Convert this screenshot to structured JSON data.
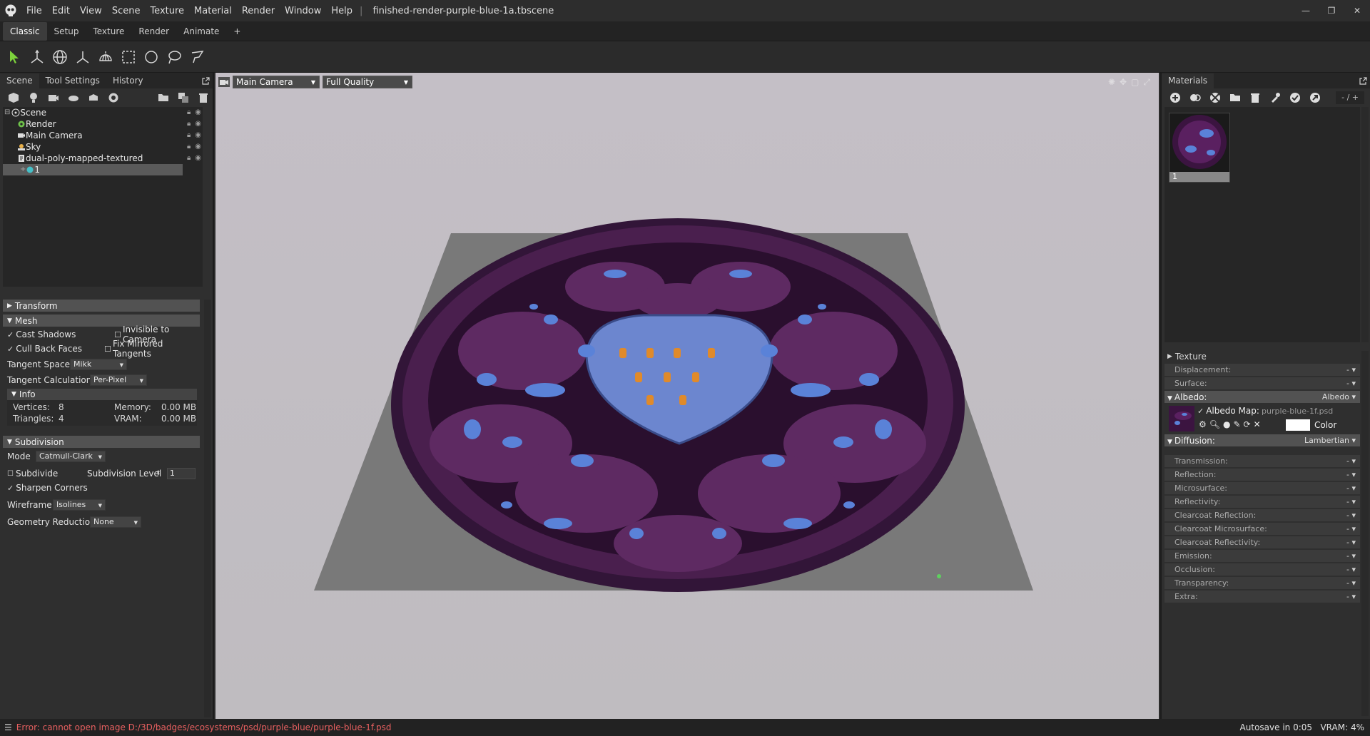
{
  "title": {
    "app_icon": "skull-icon",
    "menus": [
      "File",
      "Edit",
      "View",
      "Scene",
      "Texture",
      "Material",
      "Render",
      "Window",
      "Help"
    ],
    "separator": "|",
    "filename": "finished-render-purple-blue-1a.tbscene"
  },
  "window_controls": {
    "minimize": "—",
    "maximize": "❐",
    "close": "✕"
  },
  "workspace_tabs": [
    "Classic",
    "Setup",
    "Texture",
    "Render",
    "Animate",
    "+"
  ],
  "toolbar_icons": [
    "select-arrow-icon",
    "transform-icon",
    "rotate-sphere-icon",
    "axis-icon",
    "globe-cage-icon",
    "marquee-rect-icon",
    "marquee-circle-icon",
    "lasso-icon",
    "polygon-lasso-icon"
  ],
  "left_panel": {
    "tabs": [
      "Scene",
      "Tool Settings",
      "History"
    ],
    "scene_tree": [
      {
        "label": "Scene",
        "icon": "scene-icon",
        "indent": 0
      },
      {
        "label": "Render",
        "icon": "render-gear-icon",
        "indent": 1
      },
      {
        "label": "Main Camera",
        "icon": "camera-icon",
        "indent": 1
      },
      {
        "label": "Sky",
        "icon": "sky-icon",
        "indent": 1
      },
      {
        "label": "dual-poly-mapped-textured",
        "icon": "mesh-icon",
        "indent": 1
      },
      {
        "label": "1",
        "icon": "material-ball-icon",
        "indent": 2
      }
    ],
    "transform_header": "Transform",
    "mesh_header": "Mesh",
    "cast_shadows": "Cast Shadows",
    "invisible_to_camera": "Invisible to Camera",
    "cull_back_faces": "Cull Back Faces",
    "fix_mirrored_tangents": "Fix Mirrored Tangents",
    "tangent_space_label": "Tangent Space",
    "tangent_space_value": "Mikk",
    "tangent_calc_label": "Tangent Calculation",
    "tangent_calc_value": "Per-Pixel",
    "info_header": "Info",
    "vertices_label": "Vertices:",
    "vertices_value": "8",
    "triangles_label": "Triangles:",
    "triangles_value": "4",
    "memory_label": "Memory:",
    "memory_value": "0.00 MB",
    "vram_label": "VRAM:",
    "vram_value": "0.00 MB",
    "subdivision_header": "Subdivision",
    "mode_label": "Mode",
    "mode_value": "Catmull-Clark",
    "subdivide": "Subdivide",
    "subdivision_level_label": "Subdivision Level",
    "subdivision_level_value": "1",
    "sharpen_corners": "Sharpen Corners",
    "wireframe_label": "Wireframe",
    "wireframe_value": "Isolines",
    "geometry_reduction_label": "Geometry Reduction",
    "geometry_reduction_value": "None"
  },
  "viewport": {
    "camera": "Main Camera",
    "quality": "Full Quality"
  },
  "materials_panel": {
    "title": "Materials",
    "counter": "- / +",
    "thumb_label": "1",
    "texture_header": "Texture",
    "displacement": "Displacement:",
    "surface": "Surface:",
    "albedo_header": "Albedo:",
    "albedo_value": "Albedo",
    "albedo_map_label": "Albedo Map:",
    "albedo_map_file": "purple-blue-1f.psd",
    "color_label": "Color",
    "diffusion_header": "Diffusion:",
    "diffusion_value": "Lambertian",
    "dash": "-",
    "rows": [
      "Transmission:",
      "Reflection:",
      "Microsurface:",
      "Reflectivity:",
      "Clearcoat Reflection:",
      "Clearcoat Microsurface:",
      "Clearcoat Reflectivity:",
      "Emission:",
      "Occlusion:",
      "Transparency:",
      "Extra:"
    ]
  },
  "status": {
    "error": "Error: cannot open image D:/3D/badges/ecosystems/psd/purple-blue/purple-blue-1f.psd",
    "autosave": "Autosave in 0:05",
    "vram": "VRAM: 4%"
  },
  "colors": {
    "accent_green": "#7cd33b",
    "error_red": "#e86060",
    "viewport_top": "#c4bfc6",
    "viewport_bottom": "#bfbcc0",
    "badge_purple": "#4a1f4e",
    "gem_blue": "#5a82d8"
  }
}
